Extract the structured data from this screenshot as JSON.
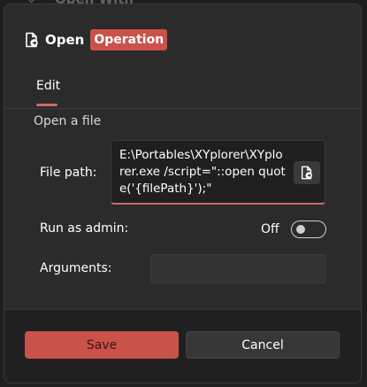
{
  "background_window": {
    "title": "Open With"
  },
  "dialog": {
    "title": "Open",
    "badge": "Operation",
    "colors": {
      "accent": "#c9524b",
      "surface": "#2b2b2b",
      "footer": "#202020"
    }
  },
  "tabs": [
    {
      "label": "Edit",
      "selected": true
    }
  ],
  "section": {
    "title": "Open a file"
  },
  "fields": {
    "file_path": {
      "label": "File path:",
      "value": "E:\\Portables\\XYplorer\\XYplorer.exe /script=\"::open quote('{filePath}');\""
    },
    "run_as_admin": {
      "label": "Run as admin:",
      "state_text": "Off",
      "checked": false
    },
    "arguments": {
      "label": "Arguments:",
      "value": ""
    }
  },
  "buttons": {
    "save": "Save",
    "cancel": "Cancel"
  }
}
